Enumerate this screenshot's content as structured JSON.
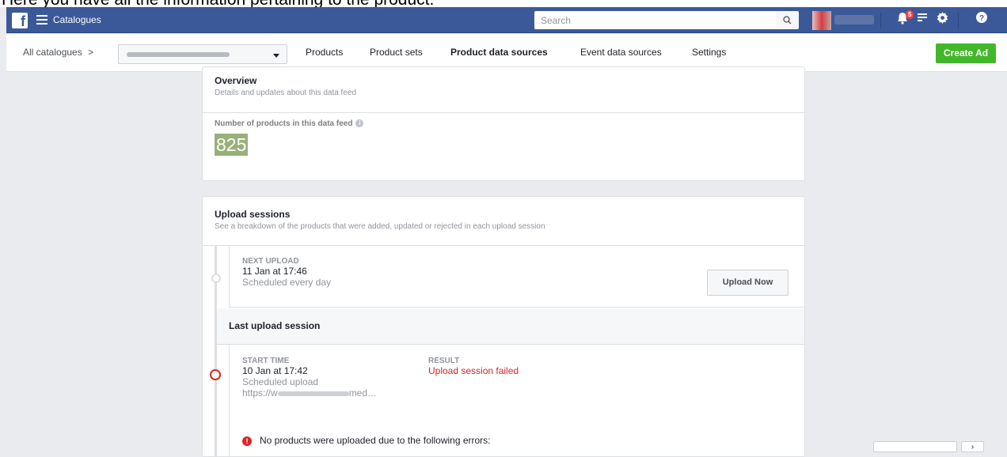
{
  "caption": "Here you have all the information pertaining to the product.",
  "topbar": {
    "app_title": "Catalogues",
    "search_placeholder": "Search",
    "notification_count": "5"
  },
  "subnav": {
    "crumb": "All catalogues",
    "tabs": [
      {
        "label": "Products"
      },
      {
        "label": "Product sets"
      },
      {
        "label": "Product data sources"
      },
      {
        "label": "Event data sources"
      },
      {
        "label": "Settings"
      }
    ],
    "active_tab": "Product data sources",
    "create_ad": "Create Ad"
  },
  "overview": {
    "title": "Overview",
    "subtitle": "Details and updates about this data feed",
    "products_label": "Number of products in this data feed",
    "products_count": "825"
  },
  "upload_sessions": {
    "title": "Upload sessions",
    "subtitle": "See a breakdown of the products that were added, updated or rejected in each upload session",
    "next_upload": {
      "label": "NEXT UPLOAD",
      "time": "11 Jan at 17:46",
      "schedule": "Scheduled every day",
      "button": "Upload Now"
    },
    "last_session_title": "Last upload session",
    "last_session": {
      "start_label": "START TIME",
      "start_time": "10 Jan at 17:42",
      "upload_type": "Scheduled upload",
      "url_prefix": "https://w",
      "url_suffix": "med…",
      "result_label": "RESULT",
      "result_value": "Upload session failed",
      "error_message": "No products were uploaded due to the following errors:"
    }
  },
  "colors": {
    "facebook_blue": "#3b5998",
    "create_green": "#42b72a",
    "error_red": "#e02424"
  }
}
